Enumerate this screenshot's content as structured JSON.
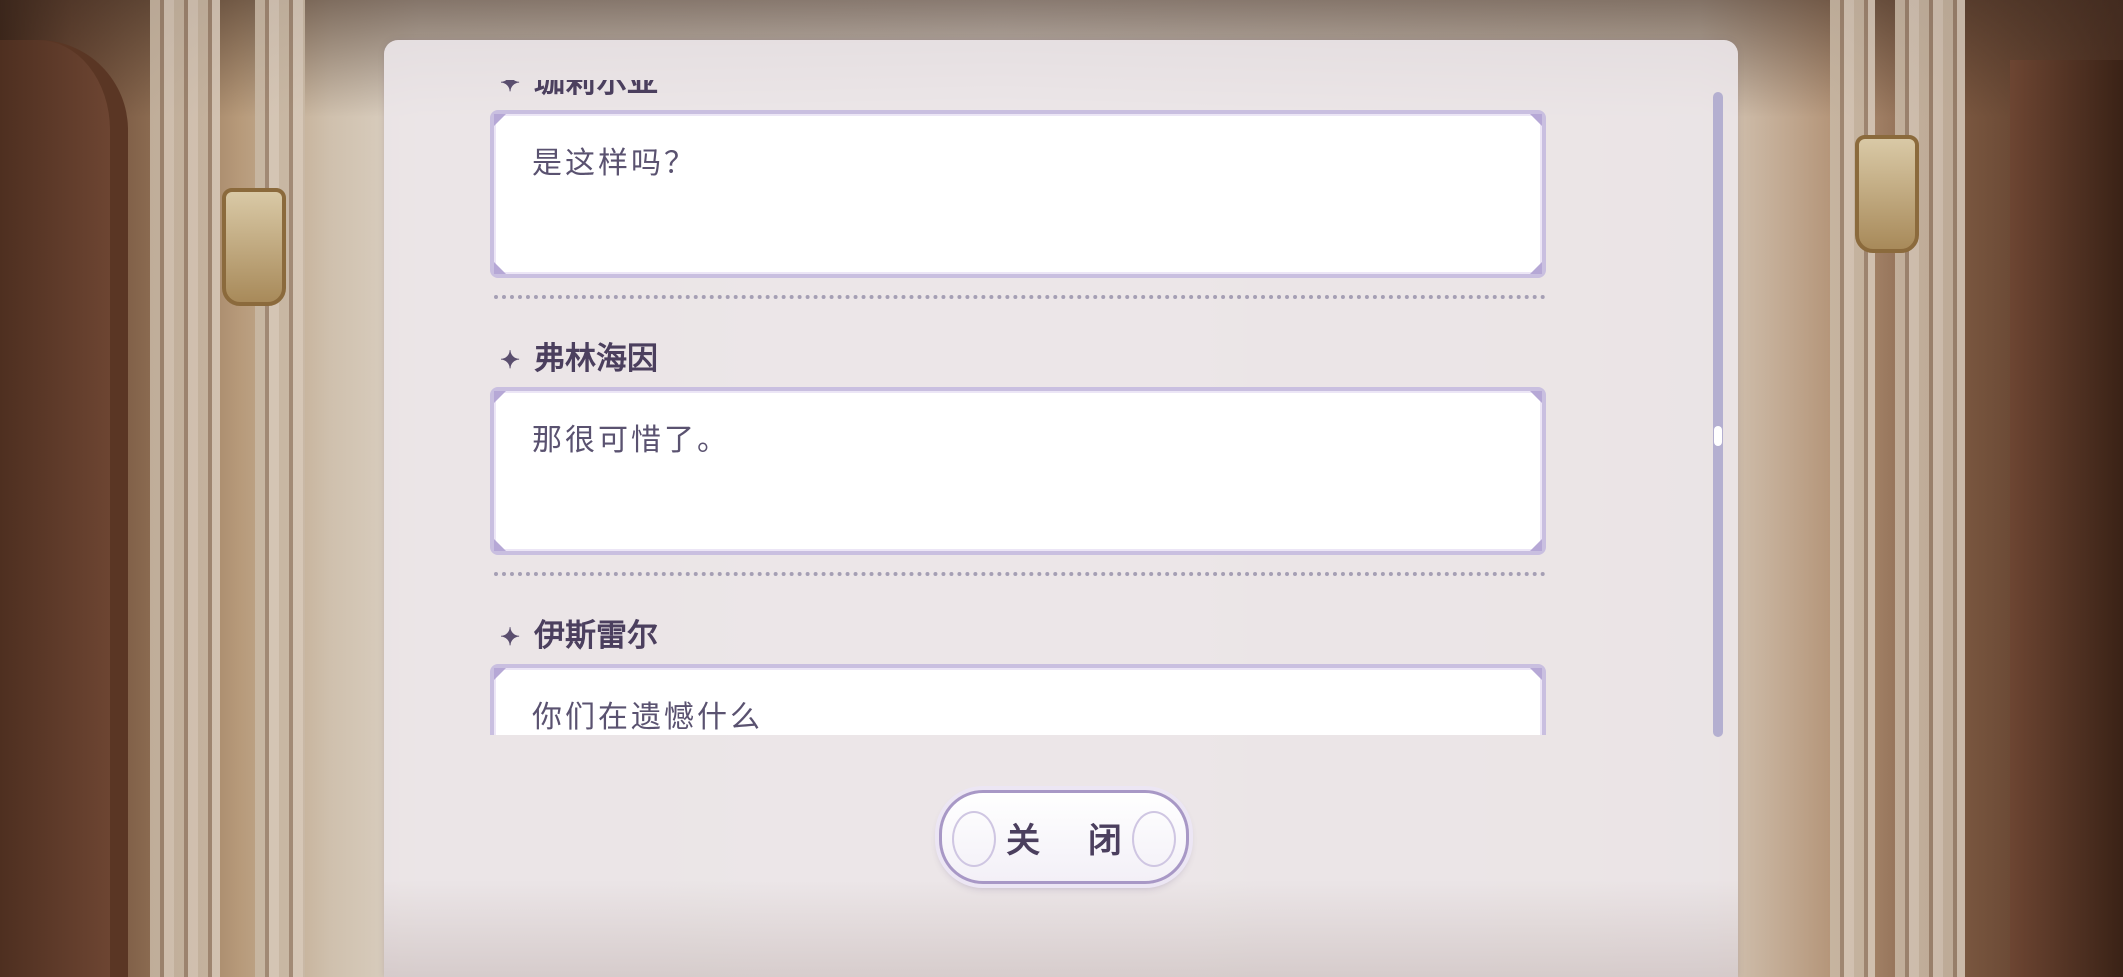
{
  "dialogue_log": {
    "entries": [
      {
        "speaker": "珈莉尔亚",
        "line": "是这样吗？"
      },
      {
        "speaker": "弗林海因",
        "line": "那很可惜了。"
      },
      {
        "speaker": "伊斯雷尔",
        "line": "你们在遗憾什么"
      }
    ]
  },
  "buttons": {
    "close_label": "关 闭"
  },
  "icons": {
    "speaker_marker": "four-point-star-icon"
  },
  "colors": {
    "panel_bg": "#ECE7EA",
    "bubble_border": "#C9BFE0",
    "speaker_text": "#4B3F5E",
    "line_text": "#5A5270",
    "scrollbar": "#B4AFD0"
  }
}
